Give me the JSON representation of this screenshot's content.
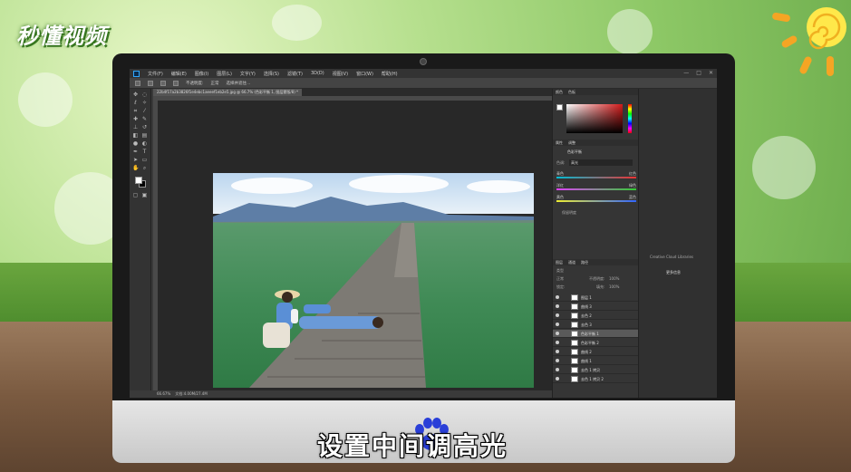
{
  "watermark": {
    "logo_text": "秒懂视频"
  },
  "subtitle": {
    "text": "设置中间调高光"
  },
  "photoshop": {
    "menu": [
      "文件(F)",
      "编辑(E)",
      "图像(I)",
      "图层(L)",
      "文字(Y)",
      "选择(S)",
      "滤镜(T)",
      "3D(D)",
      "视图(V)",
      "窗口(W)",
      "帮助(H)"
    ],
    "window_controls": [
      "—",
      "□",
      "✕"
    ],
    "options": {
      "opacity_label": "不透明度:",
      "mode_label": "正常",
      "mask_label": "选择并遮住..."
    },
    "doc_tab": "22b4f17a2b3826f1e4ebc1aeeef1eb2e5.jpg @ 66.7% (色彩平衡 1, 图层蒙版/8) *",
    "status": {
      "zoom": "66.67%",
      "doc": "文档:4.00M/27.4M"
    },
    "panels": {
      "color_tabs": [
        "颜色",
        "色板"
      ],
      "properties_tabs": [
        "属性",
        "调整"
      ],
      "properties_title": "色彩平衡",
      "tone_label": "色调:",
      "tone_value": "高光",
      "sliders": [
        {
          "left": "青色",
          "right": "红色",
          "value": "0"
        },
        {
          "left": "洋红",
          "right": "绿色",
          "value": "0"
        },
        {
          "left": "黄色",
          "right": "蓝色",
          "value": "0"
        }
      ],
      "preserve_luminosity": "保留明度",
      "layers_tabs": [
        "图层",
        "通道",
        "路径"
      ],
      "layers_kind": "类型",
      "blend_mode": "正常",
      "opacity_label": "不透明度:",
      "opacity_value": "100%",
      "lock_label": "锁定:",
      "fill_label": "填充:",
      "fill_value": "100%",
      "layers": [
        {
          "name": "图层 1",
          "active": false
        },
        {
          "name": "曲线 3",
          "active": false
        },
        {
          "name": "去色 2",
          "active": false
        },
        {
          "name": "去色 3",
          "active": false
        },
        {
          "name": "色彩平衡 1",
          "active": true
        },
        {
          "name": "色彩平衡 2",
          "active": false
        },
        {
          "name": "曲线 2",
          "active": false
        },
        {
          "name": "曲线 1",
          "active": false
        },
        {
          "name": "去色 1 拷贝",
          "active": false
        },
        {
          "name": "去色 1 拷贝 2",
          "active": false
        }
      ],
      "library_text": "Creative Cloud Libraries",
      "library_link": "更多信息"
    }
  },
  "colors": {
    "accent": "#31a8ff",
    "panel_bg": "#353535",
    "subtitle_fill": "#ffffff"
  }
}
